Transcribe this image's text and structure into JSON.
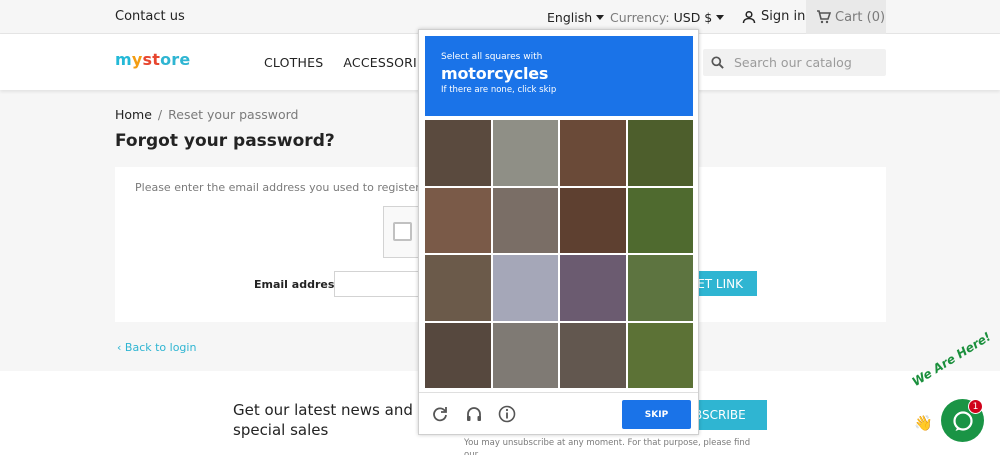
{
  "topbar": {
    "contact": "Contact us",
    "language": "English",
    "currency_label": "Currency:",
    "currency_value": "USD $",
    "signin": "Sign in",
    "cart": "Cart (0)"
  },
  "header": {
    "logo": {
      "m": "m",
      "y": "y",
      "s1": "st",
      "s2": "ore"
    },
    "nav": [
      "CLOTHES",
      "ACCESSORIES"
    ],
    "search_placeholder": "Search our catalog"
  },
  "breadcrumb": {
    "home": "Home",
    "separator": "/",
    "current": "Reset your password"
  },
  "page_title": "Forgot your password?",
  "form": {
    "instructions": "Please enter the email address you used to register. You w",
    "email_label": "Email address",
    "email_value": "",
    "send_label": "SET LINK"
  },
  "back_link": "Back to login",
  "footer": {
    "newsletter_title": "Get our latest news and special sales",
    "subscribe_label": "BSCRIBE",
    "unsubscribe_text": "You may unsubscribe at any moment. For that purpose, please find our"
  },
  "chat": {
    "label": "We Are Here!",
    "badge": "1"
  },
  "captcha": {
    "line1": "Select all squares with",
    "target": "motorcycles",
    "line3": "If there are none, click skip",
    "skip_label": "SKIP",
    "tiles": [
      "#5a4a3e",
      "#8f8f86",
      "#6a4a38",
      "#4d5e2c",
      "#7a5a48",
      "#7a6e66",
      "#5e4030",
      "#4f6a2f",
      "#6b5a4a",
      "#a5a7b8",
      "#6b5b70",
      "#5d7440",
      "#56483e",
      "#7f7a74",
      "#62574f",
      "#5c7236"
    ]
  },
  "colors": {
    "accent": "#2fb5d2",
    "captcha_blue": "#1a73e8",
    "chat_green": "#1a9445"
  }
}
